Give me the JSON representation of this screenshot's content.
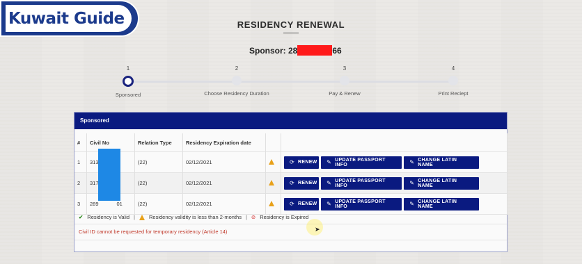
{
  "watermark": {
    "text": "Kuwait Guide"
  },
  "page": {
    "title": "RESIDENCY RENEWAL",
    "sponsor_label": "Sponsor: 28",
    "sponsor_suffix": "66"
  },
  "stepper": {
    "steps": [
      {
        "num": "1",
        "label": "Sponsored",
        "active": true
      },
      {
        "num": "2",
        "label": "Choose Residency Duration",
        "active": false
      },
      {
        "num": "3",
        "label": "Pay & Renew",
        "active": false
      },
      {
        "num": "4",
        "label": "Print Reciept",
        "active": false
      }
    ]
  },
  "panel": {
    "title": "Sponsored",
    "columns": [
      "#",
      "Civil No",
      "Relation Type",
      "Residency Expiration date",
      "",
      ""
    ],
    "rows": [
      {
        "index": "1",
        "civil_no_start": "313",
        "civil_no_end": "9",
        "relation": "(22)",
        "expiry": "02/12/2021",
        "status_icon": "warning-icon"
      },
      {
        "index": "2",
        "civil_no_start": "317",
        "civil_no_end": "6",
        "relation": "(22)",
        "expiry": "02/12/2021",
        "status_icon": "warning-icon"
      },
      {
        "index": "3",
        "civil_no_start": "289",
        "civil_no_end": "01",
        "relation": "(22)",
        "expiry": "02/12/2021",
        "status_icon": "warning-icon"
      }
    ],
    "actions": {
      "renew": "RENEW",
      "update_passport": "UPDATE PASSPORT INFO",
      "change_latin": "CHANGE LATIN NAME"
    },
    "legend": {
      "valid": "Residency is Valid",
      "less_than_2_months": "Residency validity is less than 2-months",
      "expired": "Residency is Expired",
      "separator": "|"
    },
    "note": "Civil ID cannot be requested for temporary residency (Article 14)"
  },
  "colors": {
    "primary": "#0a1a80",
    "warning": "#e8a11a",
    "valid": "#2e8b1e",
    "expired": "#d32f2f",
    "note": "#c0392b",
    "redaction_red": "#ff1a1a",
    "redaction_blue": "#1e88e5"
  }
}
